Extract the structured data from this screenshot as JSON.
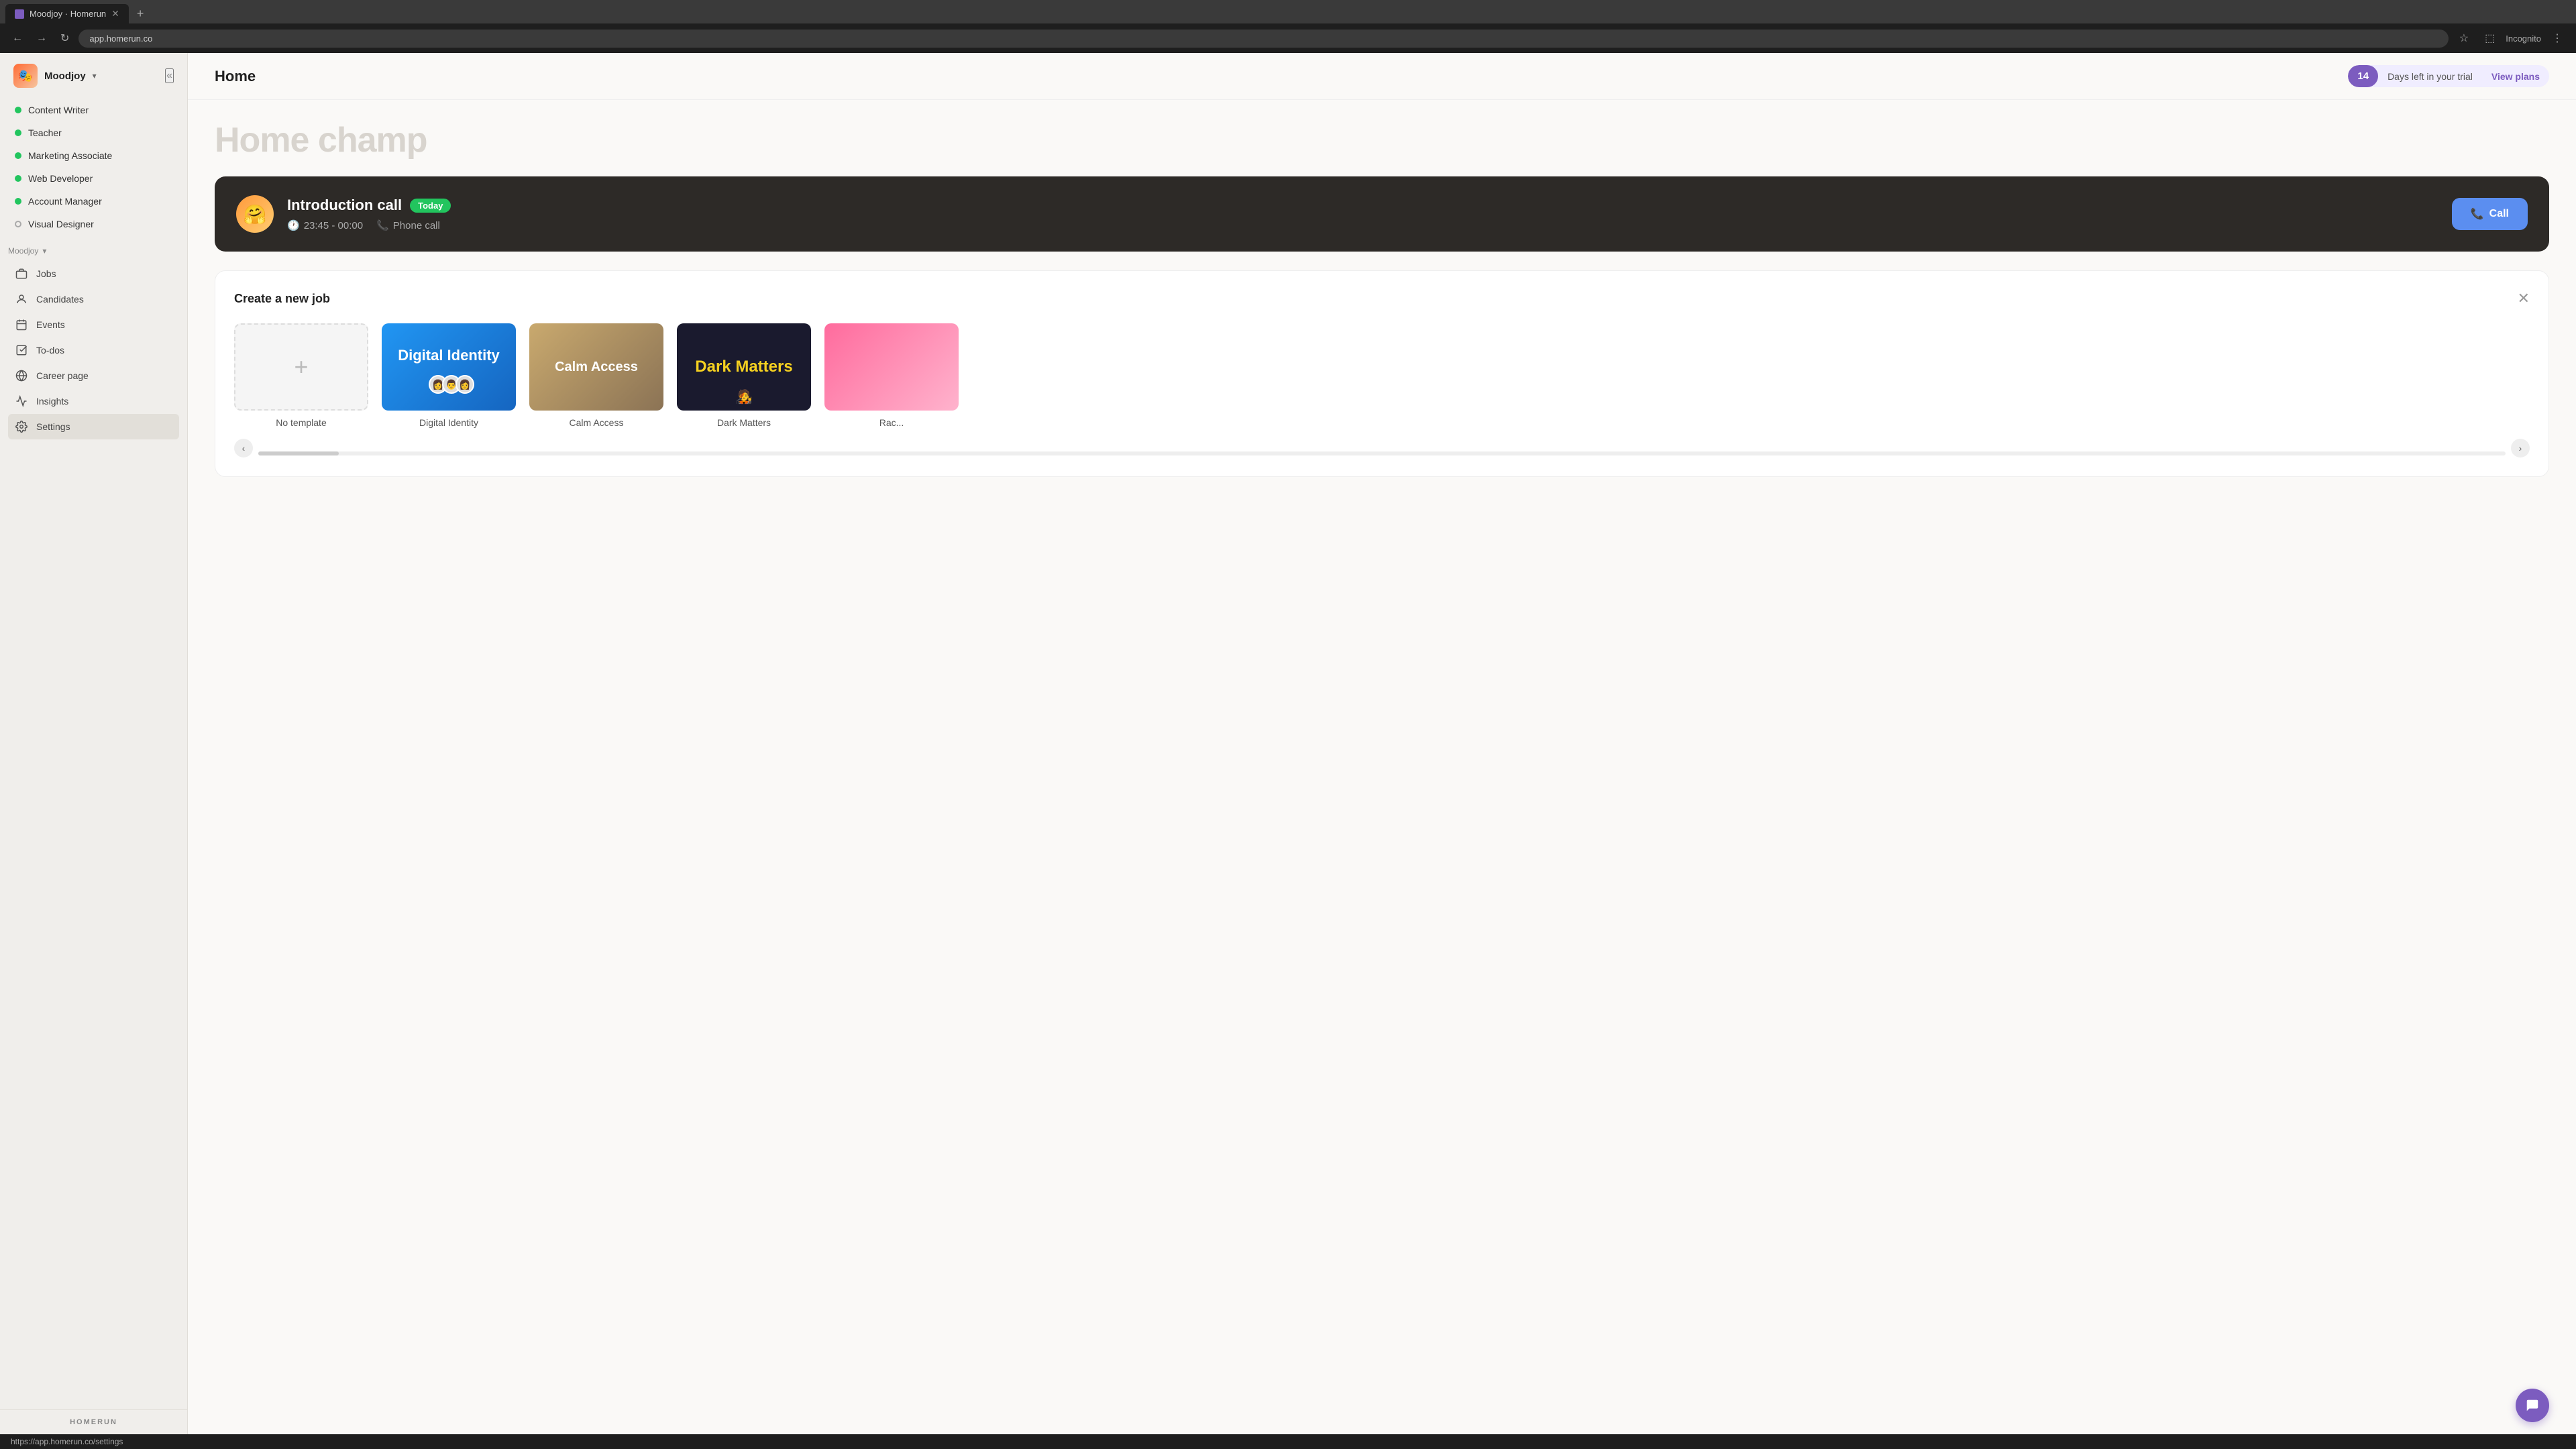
{
  "browser": {
    "tab_title": "Moodjoy · Homerun",
    "url": "app.homerun.co",
    "incognito_label": "Incognito",
    "new_tab_label": "+"
  },
  "header": {
    "page_title": "Home",
    "trial_count": "14",
    "trial_text": "Days left in your trial",
    "trial_link": "View plans"
  },
  "sidebar": {
    "company_name": "Moodjoy",
    "jobs": [
      {
        "name": "Content Writer",
        "status": "active"
      },
      {
        "name": "Teacher",
        "status": "active"
      },
      {
        "name": "Marketing Associate",
        "status": "active"
      },
      {
        "name": "Web Developer",
        "status": "active"
      },
      {
        "name": "Account Manager",
        "status": "active"
      },
      {
        "name": "Visual Designer",
        "status": "inactive"
      }
    ],
    "section_label": "Moodjoy",
    "nav_items": [
      {
        "id": "jobs",
        "label": "Jobs",
        "icon": "briefcase"
      },
      {
        "id": "candidates",
        "label": "Candidates",
        "icon": "person"
      },
      {
        "id": "events",
        "label": "Events",
        "icon": "calendar"
      },
      {
        "id": "todos",
        "label": "To-dos",
        "icon": "check"
      },
      {
        "id": "career",
        "label": "Career page",
        "icon": "globe"
      },
      {
        "id": "insights",
        "label": "Insights",
        "icon": "chart"
      },
      {
        "id": "settings",
        "label": "Settings",
        "icon": "gear",
        "active": true
      }
    ],
    "homerun_logo": "HOMERUN"
  },
  "main": {
    "ghost_title": "Home champ",
    "intro_card": {
      "title": "Introduction call",
      "badge": "Today",
      "time": "23:45 - 00:00",
      "type": "Phone call",
      "call_button": "Call"
    },
    "create_job": {
      "title": "Create a new job",
      "templates": [
        {
          "id": "no-template",
          "name": "No template",
          "type": "empty"
        },
        {
          "id": "digital-identity",
          "name": "Digital Identity",
          "type": "digital"
        },
        {
          "id": "calm-access",
          "name": "Calm Access",
          "type": "calm"
        },
        {
          "id": "dark-matters",
          "name": "Dark Matters",
          "type": "dark"
        },
        {
          "id": "rac",
          "name": "Rac...",
          "type": "rac"
        }
      ]
    }
  },
  "status_bar": {
    "url": "https://app.homerun.co/settings"
  }
}
